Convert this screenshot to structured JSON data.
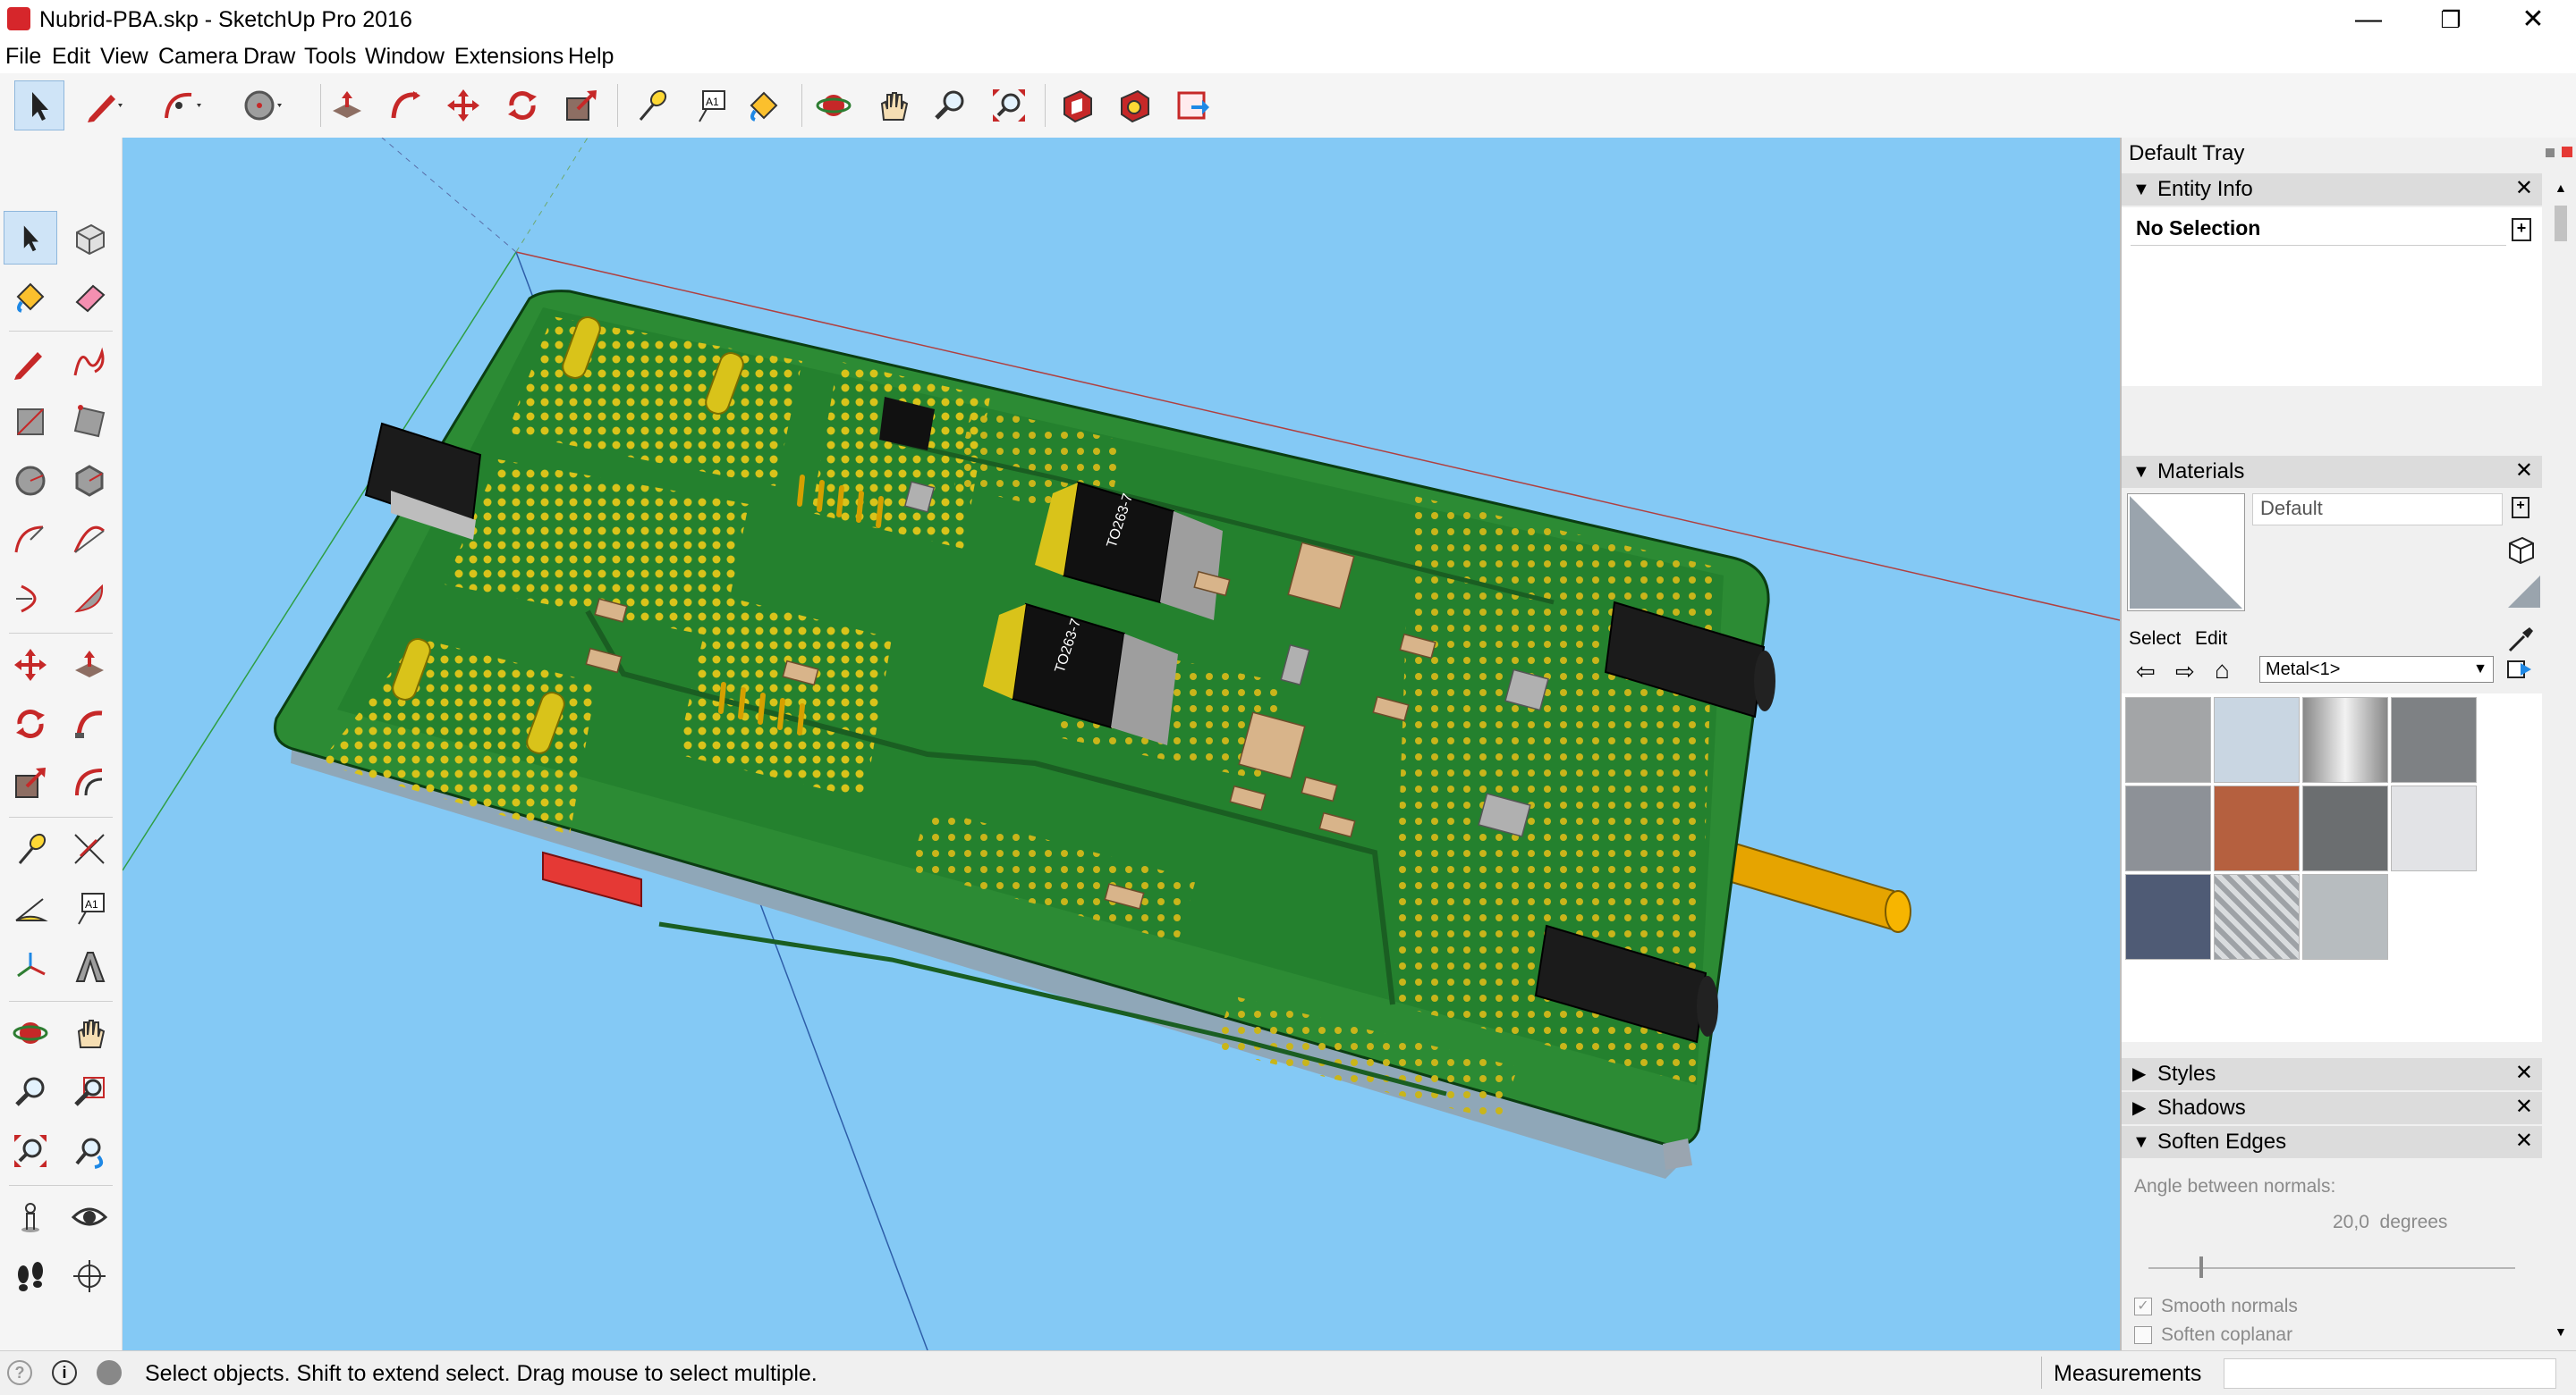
{
  "window": {
    "title": "Nubrid-PBA.skp - SketchUp Pro 2016",
    "minimize": "—",
    "restore": "❐",
    "close": "✕"
  },
  "menu": [
    "File",
    "Edit",
    "View",
    "Camera",
    "Draw",
    "Tools",
    "Window",
    "Extensions",
    "Help"
  ],
  "toolbar": {
    "icons": [
      "select-icon",
      "pencil-icon",
      "arc-icon",
      "circle-icon",
      "push-pull-icon",
      "follow-me-icon",
      "move-icon",
      "rotate-icon",
      "scale-icon",
      "tape-measure-icon",
      "text-label-icon",
      "paint-bucket-icon",
      "orbit-icon",
      "pan-icon",
      "zoom-icon",
      "zoom-extents-icon",
      "3d-warehouse-icon",
      "extension-warehouse-icon",
      "share-model-icon"
    ]
  },
  "tray": {
    "title": "Default Tray",
    "entity_info": {
      "title": "Entity Info",
      "selection": "No Selection"
    },
    "materials": {
      "title": "Materials",
      "current": "Default",
      "tab_select": "Select",
      "tab_edit": "Edit",
      "collection": "Metal<1>",
      "swatches": [
        "#a3a5a7",
        "#c9d6e2",
        "#b0b0b0",
        "#7e8184",
        "#8d9197",
        "#b5603f",
        "#6b6e70",
        "#e2e3e6",
        "#4f5b75",
        "#c1c4c8",
        "#b7bcbf"
      ]
    },
    "styles": "Styles",
    "shadows": "Shadows",
    "soften_edges": {
      "title": "Soften Edges",
      "angle_label": "Angle between normals:",
      "angle_value": "20,0  degrees",
      "slider_fraction": 0.14,
      "smooth_normals": "Smooth normals",
      "soften_coplanar": "Soften coplanar"
    }
  },
  "status": {
    "message": "Select objects. Shift to extend select. Drag mouse to select multiple.",
    "measurements_label": "Measurements",
    "measurements_value": ""
  },
  "pcb": {
    "chip_label_1": "TO263-7",
    "chip_label_2": "TO263-7"
  }
}
